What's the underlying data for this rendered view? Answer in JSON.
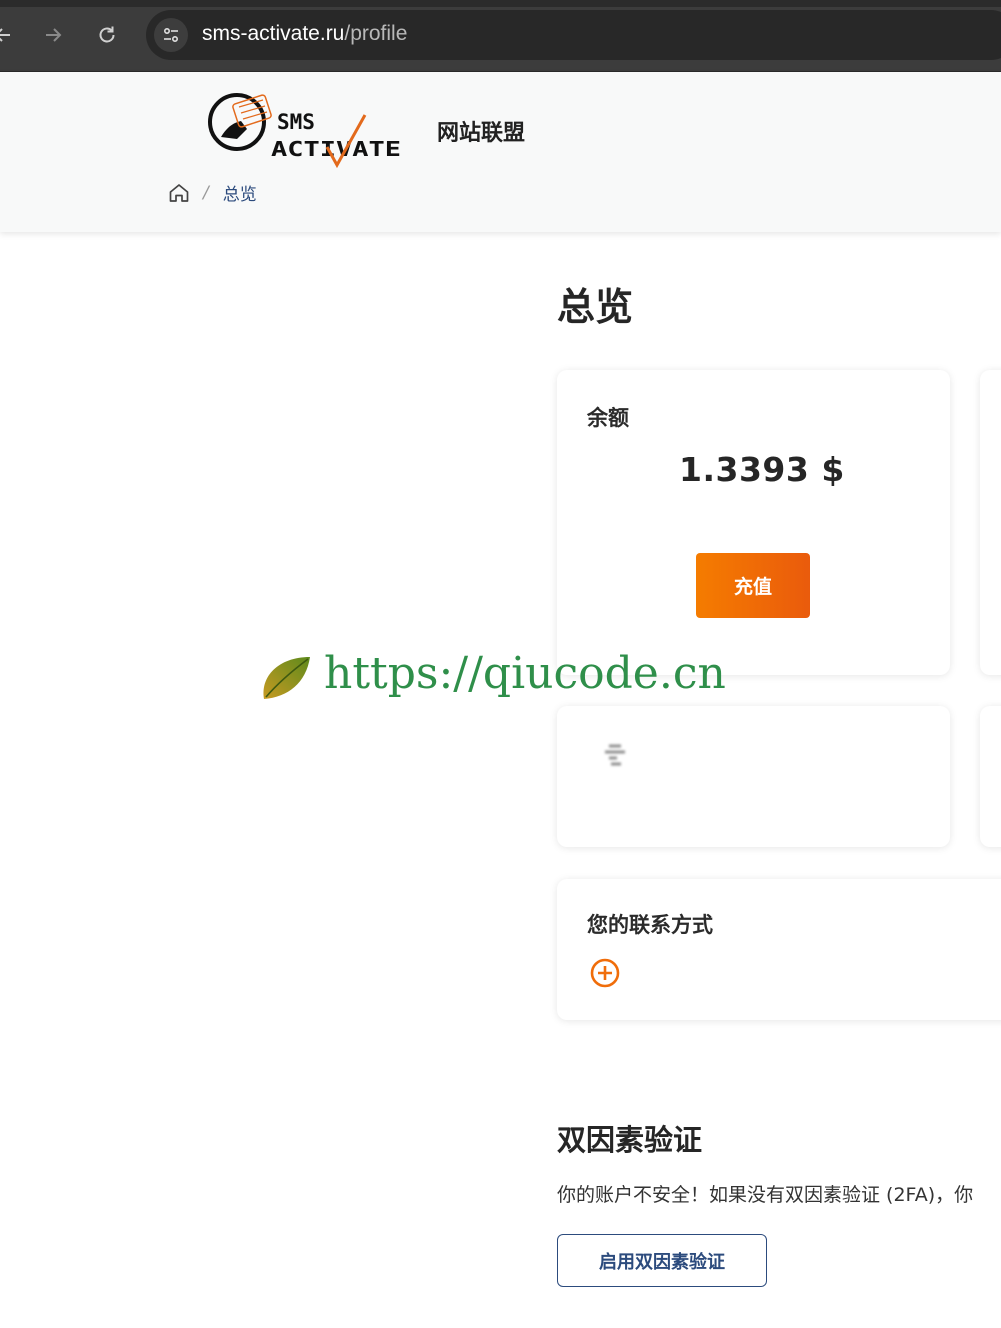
{
  "browser": {
    "url_host": "sms-activate.ru",
    "url_path": "/profile"
  },
  "header": {
    "logo_line1": "SMS",
    "logo_line2": "ACTIVATE",
    "partner_title": "网站联盟",
    "breadcrumb": {
      "current": "总览",
      "separator": "/"
    }
  },
  "main": {
    "page_title": "总览",
    "balance": {
      "label": "余额",
      "value": "1.3393 $",
      "topup_label": "充值"
    },
    "contact": {
      "title": "您的联系方式"
    }
  },
  "watermark": {
    "text": "https://qiucode.cn"
  },
  "two_factor": {
    "title": "双因素验证",
    "description": "你的账户不安全！如果没有双因素验证 (2FA)，你",
    "button_label": "启用双因素验证"
  },
  "colors": {
    "accent_orange": "#f57c00",
    "link_blue": "#2c4b7d",
    "watermark_green": "#2f8f4a"
  },
  "icons": [
    "back-arrow-icon",
    "forward-arrow-icon",
    "reload-icon",
    "site-settings-icon",
    "home-icon",
    "plus-circle-icon",
    "leaf-icon"
  ]
}
